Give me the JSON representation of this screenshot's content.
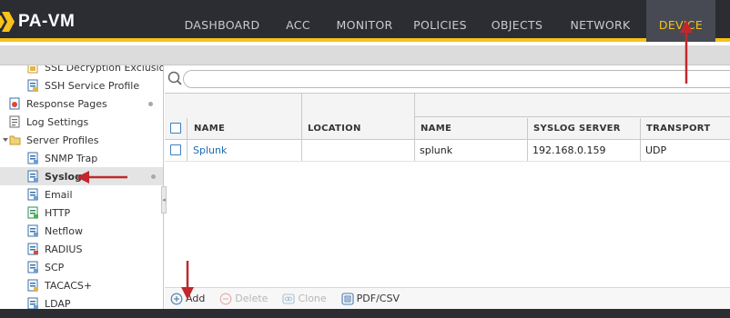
{
  "app": {
    "title": "PA-VM"
  },
  "nav": {
    "tabs": [
      {
        "label": "DASHBOARD"
      },
      {
        "label": "ACC"
      },
      {
        "label": "MONITOR"
      },
      {
        "label": "POLICIES"
      },
      {
        "label": "OBJECTS"
      },
      {
        "label": "NETWORK"
      },
      {
        "label": "DEVICE"
      }
    ],
    "active": "DEVICE"
  },
  "tree": {
    "items": [
      {
        "label": "SSL Decryption Exclusion"
      },
      {
        "label": "SSH Service Profile"
      },
      {
        "label": "Response Pages"
      },
      {
        "label": "Log Settings"
      },
      {
        "label": "Server Profiles"
      },
      {
        "label": "SNMP Trap"
      },
      {
        "label": "Syslog"
      },
      {
        "label": "Email"
      },
      {
        "label": "HTTP"
      },
      {
        "label": "Netflow"
      },
      {
        "label": "RADIUS"
      },
      {
        "label": "SCP"
      },
      {
        "label": "TACACS+"
      },
      {
        "label": "LDAP"
      }
    ],
    "selected": "Syslog"
  },
  "search": {
    "value": "",
    "placeholder": ""
  },
  "table": {
    "columns": [
      "NAME",
      "LOCATION",
      "NAME",
      "SYSLOG SERVER",
      "TRANSPORT"
    ],
    "rows": [
      {
        "name": "Splunk",
        "location": "",
        "server_name": "splunk",
        "syslog_server": "192.168.0.159",
        "transport": "UDP"
      }
    ]
  },
  "footer": {
    "add": "Add",
    "delete": "Delete",
    "clone": "Clone",
    "pdf_csv": "PDF/CSV"
  },
  "colors": {
    "topbar": "#2b2d33",
    "accent": "#f8c21b",
    "link": "#1f6bb3",
    "annotation_arrow": "#c0282d"
  }
}
